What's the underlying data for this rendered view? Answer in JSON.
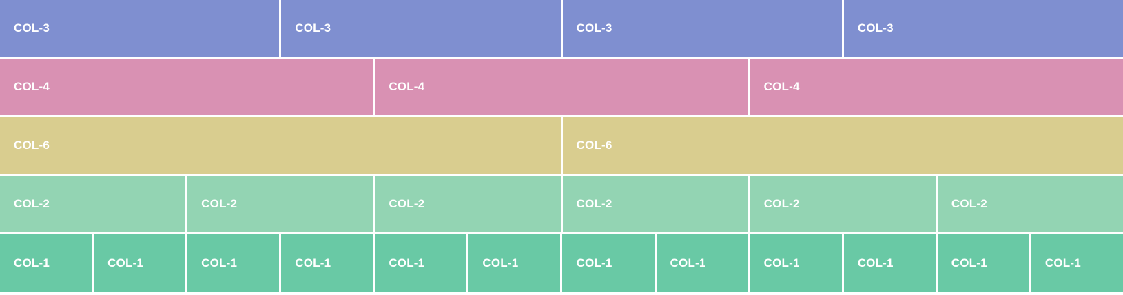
{
  "rows": [
    {
      "name": "row-col-3",
      "span": 3,
      "color": "#7f8fd0",
      "cells": [
        "COL-3",
        "COL-3",
        "COL-3",
        "COL-3"
      ]
    },
    {
      "name": "row-col-4",
      "span": 4,
      "color": "#d991b3",
      "cells": [
        "COL-4",
        "COL-4",
        "COL-4"
      ]
    },
    {
      "name": "row-col-6",
      "span": 6,
      "color": "#d9cd8f",
      "cells": [
        "COL-6",
        "COL-6"
      ]
    },
    {
      "name": "row-col-2",
      "span": 2,
      "color": "#93d4b3",
      "cells": [
        "COL-2",
        "COL-2",
        "COL-2",
        "COL-2",
        "COL-2",
        "COL-2"
      ]
    },
    {
      "name": "row-col-1",
      "span": 1,
      "color": "#69c9a5",
      "cells": [
        "COL-1",
        "COL-1",
        "COL-1",
        "COL-1",
        "COL-1",
        "COL-1",
        "COL-1",
        "COL-1",
        "COL-1",
        "COL-1",
        "COL-1",
        "COL-1"
      ]
    }
  ]
}
